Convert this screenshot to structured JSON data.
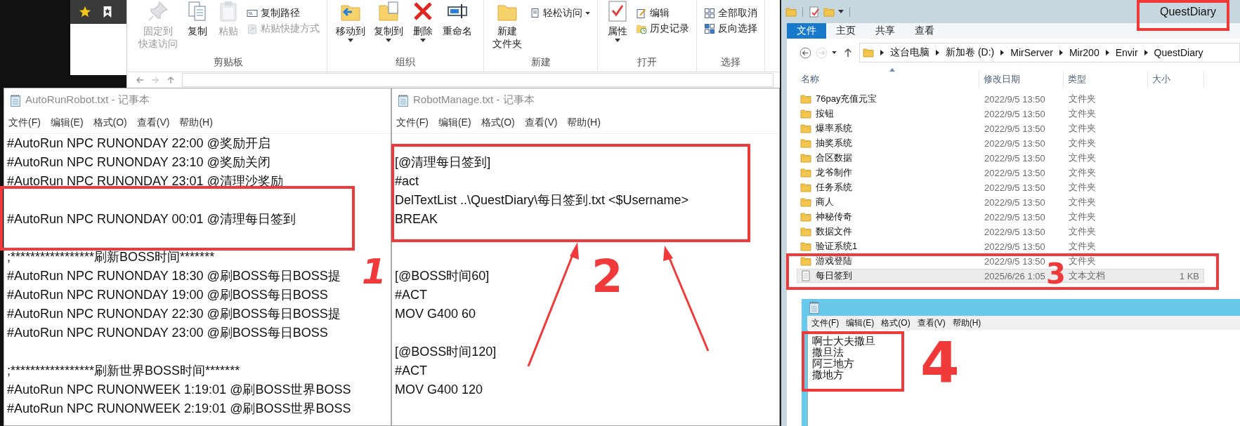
{
  "explorer_back": {
    "ribbon_groups": [
      {
        "label": "剪贴板",
        "items": [
          {
            "kind": "large",
            "label": [
              "固定到",
              "快速访问"
            ],
            "disabled": true,
            "dropdown": false
          },
          {
            "kind": "large",
            "label": [
              "复制"
            ],
            "disabled": false,
            "dropdown": false
          },
          {
            "kind": "large",
            "label": [
              "粘贴"
            ],
            "disabled": true,
            "dropdown": false
          },
          {
            "kind": "small",
            "label": "复制路径",
            "disabled": false,
            "dropdown": false
          },
          {
            "kind": "small",
            "label": "粘贴快捷方式",
            "disabled": true,
            "dropdown": false
          }
        ]
      },
      {
        "label": "组织",
        "items": [
          {
            "kind": "large",
            "label": [
              "移动到"
            ],
            "disabled": false,
            "dropdown": true
          },
          {
            "kind": "large",
            "label": [
              "复制到"
            ],
            "disabled": false,
            "dropdown": true
          },
          {
            "kind": "large",
            "label": [
              "删除"
            ],
            "disabled": false,
            "dropdown": true
          },
          {
            "kind": "large",
            "label": [
              "重命名"
            ],
            "disabled": false,
            "dropdown": false
          }
        ]
      },
      {
        "label": "新建",
        "items": [
          {
            "kind": "large",
            "label": [
              "新建",
              "文件夹"
            ],
            "disabled": false,
            "dropdown": false
          },
          {
            "kind": "small",
            "label": "轻松访问",
            "disabled": false,
            "dropdown": true
          }
        ]
      },
      {
        "label": "打开",
        "items": [
          {
            "kind": "large",
            "label": [
              "属性"
            ],
            "disabled": false,
            "dropdown": true
          },
          {
            "kind": "small",
            "label": "编辑",
            "disabled": false,
            "dropdown": false
          },
          {
            "kind": "small",
            "label": "历史记录",
            "disabled": false,
            "dropdown": false
          }
        ]
      },
      {
        "label": "选择",
        "items": [
          {
            "kind": "small",
            "label": "全部取消",
            "disabled": false,
            "dropdown": false
          },
          {
            "kind": "small",
            "label": "反向选择",
            "disabled": false,
            "dropdown": false
          }
        ]
      }
    ]
  },
  "notepads": [
    {
      "kind": "modern",
      "title": "AutoRunRobot.txt - 记事本",
      "menu": [
        "文件(F)",
        "编辑(E)",
        "格式(O)",
        "查看(V)",
        "帮助(H)"
      ],
      "lines": [
        {
          "kind": "text",
          "text": "#AutoRun NPC RUNONDAY 22:00 @奖励开启"
        },
        {
          "kind": "text",
          "text": "#AutoRun NPC RUNONDAY 23:10 @奖励关闭"
        },
        {
          "kind": "text",
          "text": "#AutoRun NPC RUNONDAY 23:01 @清理沙奖励"
        },
        {
          "kind": "blank"
        },
        {
          "kind": "text",
          "text": "#AutoRun NPC RUNONDAY 00:01 @清理每日签到"
        },
        {
          "kind": "blank"
        },
        {
          "kind": "text",
          "text": ";*****************刷新BOSS时间*******"
        },
        {
          "kind": "text",
          "text": "#AutoRun NPC RUNONDAY 18:30 @刷BOSS每日BOSS提"
        },
        {
          "kind": "text",
          "text": "#AutoRun NPC RUNONDAY 19:00 @刷BOSS每日BOSS"
        },
        {
          "kind": "text",
          "text": "#AutoRun NPC RUNONDAY 22:30 @刷BOSS每日BOSS提"
        },
        {
          "kind": "text",
          "text": "#AutoRun NPC RUNONDAY 23:00 @刷BOSS每日BOSS"
        },
        {
          "kind": "blank"
        },
        {
          "kind": "text",
          "text": ";*****************刷新世界BOSS时间*******"
        },
        {
          "kind": "text",
          "text": "#AutoRun NPC RUNONWEEK 1:19:01 @刷BOSS世界BOSS"
        },
        {
          "kind": "text",
          "text": "#AutoRun NPC RUNONWEEK 2:19:01 @刷BOSS世界BOSS"
        }
      ]
    },
    {
      "kind": "modern",
      "title": "RobotManage.txt - 记事本",
      "menu": [
        "文件(F)",
        "编辑(E)",
        "格式(O)",
        "查看(V)",
        "帮助(H)"
      ],
      "lines": [
        {
          "kind": "blank"
        },
        {
          "kind": "text",
          "text": "[@清理每日签到]"
        },
        {
          "kind": "text",
          "text": "#act"
        },
        {
          "kind": "text",
          "text": "DelTextList ..\\QuestDiary\\每日签到.txt <$Username>"
        },
        {
          "kind": "text",
          "text": "BREAK"
        },
        {
          "kind": "blank"
        },
        {
          "kind": "blank"
        },
        {
          "kind": "text",
          "text": "[@BOSS时间60]"
        },
        {
          "kind": "text",
          "text": "#ACT"
        },
        {
          "kind": "text",
          "text": "MOV G400 60"
        },
        {
          "kind": "blank"
        },
        {
          "kind": "text",
          "text": "[@BOSS时间120]"
        },
        {
          "kind": "text",
          "text": "#ACT"
        },
        {
          "kind": "text",
          "text": "MOV G400 120"
        }
      ]
    },
    {
      "kind": "classic",
      "menu": [
        "文件(F)",
        "编辑(E)",
        "格式(O)",
        "查看(V)",
        "帮助(H)"
      ],
      "lines": [
        {
          "kind": "text",
          "text": "啊士大夫撒旦"
        },
        {
          "kind": "text",
          "text": "撒旦法"
        },
        {
          "kind": "text",
          "text": "阿三地方"
        },
        {
          "kind": "text",
          "text": "撒地方"
        }
      ]
    }
  ],
  "explorer_front": {
    "title": "QuestDiary",
    "tabs": [
      {
        "kind": "menu",
        "label": "文件"
      },
      {
        "kind": "tab",
        "label": "主页"
      },
      {
        "kind": "tab",
        "label": "共享"
      },
      {
        "kind": "tab",
        "label": "查看"
      }
    ],
    "path": [
      "这台电脑",
      "新加卷 (D:)",
      "MirServer",
      "Mir200",
      "Envir",
      "QuestDiary"
    ],
    "columns": [
      "名称",
      "修改日期",
      "类型",
      "大小"
    ],
    "rows": [
      {
        "kind": "folder",
        "name": "76pay充值元宝",
        "date": "2022/9/5 13:50",
        "type": "文件夹",
        "selected": false
      },
      {
        "kind": "folder",
        "name": "按钮",
        "date": "2022/9/5 13:50",
        "type": "文件夹",
        "selected": false
      },
      {
        "kind": "folder",
        "name": "爆率系统",
        "date": "2022/9/5 13:50",
        "type": "文件夹",
        "selected": false
      },
      {
        "kind": "folder",
        "name": "抽奖系统",
        "date": "2022/9/5 13:50",
        "type": "文件夹",
        "selected": false
      },
      {
        "kind": "folder",
        "name": "合区数据",
        "date": "2022/9/5 13:50",
        "type": "文件夹",
        "selected": false
      },
      {
        "kind": "folder",
        "name": "龙爷制作",
        "date": "2022/9/5 13:50",
        "type": "文件夹",
        "selected": false
      },
      {
        "kind": "folder",
        "name": "任务系统",
        "date": "2022/9/5 13:50",
        "type": "文件夹",
        "selected": false
      },
      {
        "kind": "folder",
        "name": "商人",
        "date": "2022/9/5 13:50",
        "type": "文件夹",
        "selected": false
      },
      {
        "kind": "folder",
        "name": "神秘传奇",
        "date": "2022/9/5 13:50",
        "type": "文件夹",
        "selected": false
      },
      {
        "kind": "folder",
        "name": "数据文件",
        "date": "2022/9/5 13:50",
        "type": "文件夹",
        "selected": false
      },
      {
        "kind": "folder",
        "name": "验证系统1",
        "date": "2022/9/5 13:50",
        "type": "文件夹",
        "selected": false
      },
      {
        "kind": "folder",
        "name": "游戏登陆",
        "date": "2022/9/5 13:50",
        "type": "文件夹",
        "selected": false
      },
      {
        "kind": "file",
        "name": "每日签到",
        "date": "2025/6/26 1:05",
        "type": "文本文档",
        "size": "1 KB",
        "selected": true
      }
    ]
  },
  "annotations": [
    {
      "label": "1"
    },
    {
      "label": "2"
    },
    {
      "label": "3"
    },
    {
      "label": "4"
    }
  ]
}
